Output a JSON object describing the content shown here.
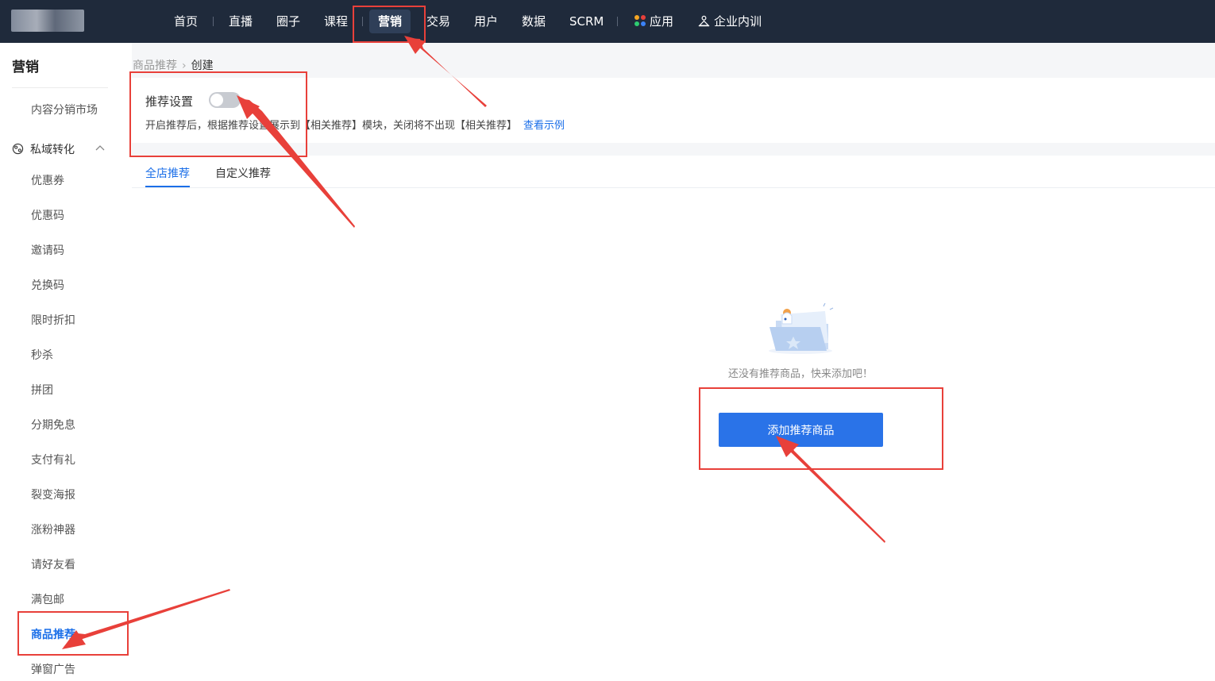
{
  "nav": {
    "items": [
      "首页",
      "直播",
      "圈子",
      "课程",
      "营销",
      "交易",
      "用户",
      "数据",
      "SCRM",
      "应用",
      "企业内训"
    ],
    "active": "营销"
  },
  "sidebar": {
    "title": "营销",
    "top_item": "内容分销市场",
    "group": "私域转化",
    "items": [
      "优惠券",
      "优惠码",
      "邀请码",
      "兑换码",
      "限时折扣",
      "秒杀",
      "拼团",
      "分期免息",
      "支付有礼",
      "裂变海报",
      "涨粉神器",
      "请好友看",
      "满包邮",
      "商品推荐",
      "弹窗广告"
    ],
    "active": "商品推荐"
  },
  "breadcrumb": {
    "parent": "商品推荐",
    "current": "创建"
  },
  "setting": {
    "label": "推荐设置",
    "enabled": false,
    "description": "开启推荐后，根据推荐设置展示到【相关推荐】模块，关闭将不出现【相关推荐】",
    "link": "查看示例"
  },
  "tabs": [
    "全店推荐",
    "自定义推荐"
  ],
  "active_tab": "全店推荐",
  "empty": {
    "text": "还没有推荐商品，快来添加吧！",
    "button": "添加推荐商品"
  },
  "colors": {
    "nav_bg": "#1f2a3b",
    "accent": "#1a6ee8",
    "button": "#2a73e8",
    "annotation": "#e8403a"
  }
}
